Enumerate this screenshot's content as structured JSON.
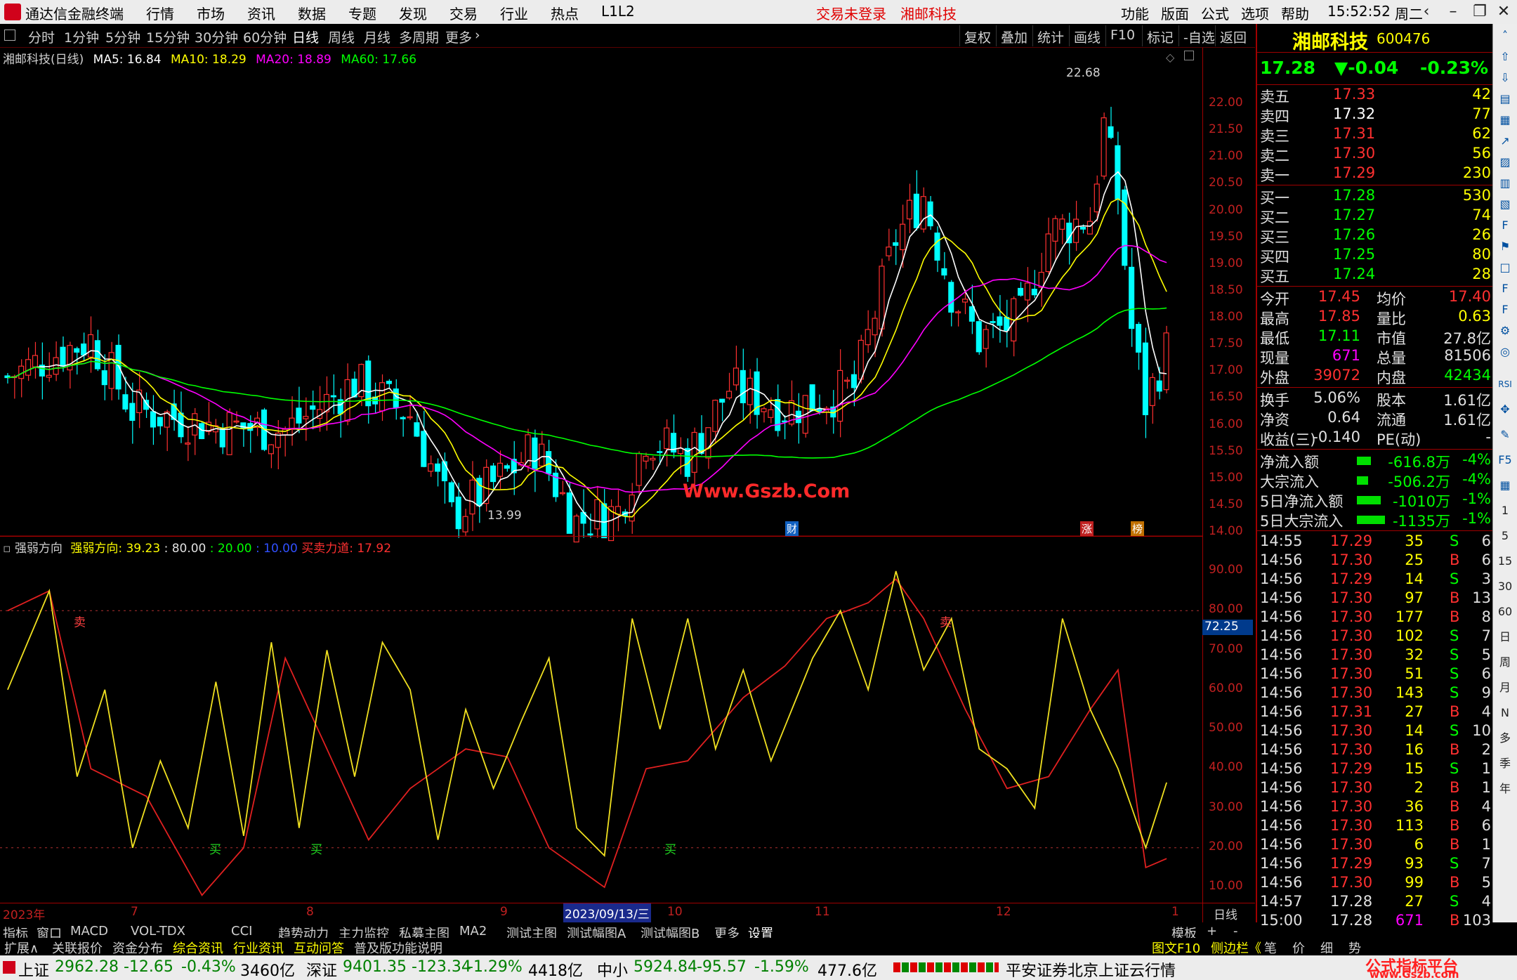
{
  "titlebar": {
    "app_title": "通达信金融终端",
    "menu": [
      "行情",
      "市场",
      "资讯",
      "数据",
      "专题",
      "发现",
      "交易",
      "行业",
      "热点",
      "L1L2"
    ],
    "trade_status": "交易未登录",
    "stock_name": "湘邮科技",
    "right_menu": [
      "功能",
      "版面",
      "公式",
      "选项",
      "帮助"
    ],
    "time": "15:52:52",
    "weekday": "周二"
  },
  "toolbar": {
    "periods": [
      "分时",
      "1分钟",
      "5分钟",
      "15分钟",
      "30分钟",
      "60分钟",
      "日线",
      "周线",
      "月线",
      "多周期",
      "更多"
    ],
    "selected": "日线",
    "buttons": [
      "复权",
      "叠加",
      "统计",
      "画线",
      "F10",
      "标记",
      "-自选",
      "返回"
    ]
  },
  "chart_header": {
    "name": "湘邮科技(日线)",
    "ma5": "MA5: 16.84",
    "ma10": "MA10: 18.29",
    "ma20": "MA20: 18.89",
    "ma60": "MA60: 17.66"
  },
  "price_axis": [
    "22.00",
    "21.50",
    "21.00",
    "20.50",
    "20.00",
    "19.50",
    "19.00",
    "18.50",
    "18.00",
    "17.50",
    "17.00",
    "16.50",
    "16.00",
    "15.50",
    "15.00",
    "14.50",
    "14.00"
  ],
  "price_annotations": {
    "high": "22.68",
    "low": "13.99",
    "markers": [
      "财",
      "涨",
      "榜"
    ]
  },
  "indicator_header": {
    "name": "强弱方向",
    "value1": "强弱方向: 39.23",
    "value2": ": 80.00",
    "value3": ": 20.00",
    "value4": ": 10.00",
    "value5": "买卖力道: 17.92"
  },
  "indicator_axis": [
    "90.00",
    "80.00",
    "70.00",
    "60.00",
    "50.00",
    "40.00",
    "30.00",
    "20.00",
    "10.00"
  ],
  "indicator_current": "72.25",
  "indicator_signals": {
    "sell": "卖",
    "buy": "买"
  },
  "watermark_center": "Www.Gszb.Com",
  "date_axis": {
    "labels": [
      "2023年",
      "7",
      "8",
      "9",
      "10",
      "11",
      "12",
      "1"
    ],
    "highlight": "2023/09/13/三",
    "period": "日线"
  },
  "bottom_tabs": [
    "指标",
    "窗口",
    "MACD",
    "VOL-TDX",
    "CCI",
    "趋势动力",
    "主力监控",
    "私募主图",
    "MA2",
    "测试主图",
    "测试幅图A",
    "测试幅图B",
    "更多",
    "设置"
  ],
  "bottom_tabs_right": [
    "模板",
    "+",
    "-"
  ],
  "bottom_tabs2": [
    "扩展∧",
    "关联报价",
    "资金分布",
    "综合资讯",
    "行业资讯",
    "互动问答",
    "普及版功能说明"
  ],
  "bottom_tabs2_right": [
    "图文F10",
    "侧边栏《",
    "笔",
    "价",
    "细",
    "势"
  ],
  "quote": {
    "name": "湘邮科技",
    "code": "600476",
    "price": "17.28",
    "change": "▼-0.04",
    "pct": "-0.23%",
    "asks": [
      {
        "label": "卖五",
        "price": "17.33",
        "vol": "42"
      },
      {
        "label": "卖四",
        "price": "17.32",
        "vol": "77"
      },
      {
        "label": "卖三",
        "price": "17.31",
        "vol": "62"
      },
      {
        "label": "卖二",
        "price": "17.30",
        "vol": "56"
      },
      {
        "label": "卖一",
        "price": "17.29",
        "vol": "230"
      }
    ],
    "bids": [
      {
        "label": "买一",
        "price": "17.28",
        "vol": "530"
      },
      {
        "label": "买二",
        "price": "17.27",
        "vol": "74"
      },
      {
        "label": "买三",
        "price": "17.26",
        "vol": "26"
      },
      {
        "label": "买四",
        "price": "17.25",
        "vol": "80"
      },
      {
        "label": "买五",
        "price": "17.24",
        "vol": "28"
      }
    ],
    "stats": [
      {
        "l1": "今开",
        "v1": "17.45",
        "l2": "均价",
        "v2": "17.40",
        "c1": "#ff3030",
        "c2": "#ff3030"
      },
      {
        "l1": "最高",
        "v1": "17.85",
        "l2": "量比",
        "v2": "0.63",
        "c1": "#ff3030",
        "c2": "#ffff00"
      },
      {
        "l1": "最低",
        "v1": "17.11",
        "l2": "市值",
        "v2": "27.8亿",
        "c1": "#00ff00",
        "c2": "#e0e0e0"
      },
      {
        "l1": "现量",
        "v1": "671",
        "l2": "总量",
        "v2": "81506",
        "c1": "#ff00ff",
        "c2": "#e0e0e0"
      },
      {
        "l1": "外盘",
        "v1": "39072",
        "l2": "内盘",
        "v2": "42434",
        "c1": "#ff3030",
        "c2": "#00ff00"
      }
    ],
    "stats2": [
      {
        "l1": "换手",
        "v1": "5.06%",
        "l2": "股本",
        "v2": "1.61亿"
      },
      {
        "l1": "净资",
        "v1": "0.64",
        "l2": "流通",
        "v2": "1.61亿"
      },
      {
        "l1": "收益(三)",
        "v1": "-0.140",
        "l2": "PE(动)",
        "v2": "-"
      }
    ],
    "flows": [
      {
        "label": "净流入额",
        "value": "-616.8万",
        "pct": "-4%",
        "w": 20
      },
      {
        "label": "大宗流入",
        "value": "-506.2万",
        "pct": "-4%",
        "w": 16
      },
      {
        "label": "5日净流入额",
        "value": "-1010万",
        "pct": "-1%",
        "w": 34
      },
      {
        "label": "5日大宗流入",
        "value": "-1135万",
        "pct": "-1%",
        "w": 40
      }
    ],
    "ticks": [
      [
        "14:55",
        "17.29",
        "35",
        "S",
        "6"
      ],
      [
        "14:56",
        "17.30",
        "25",
        "B",
        "6"
      ],
      [
        "14:56",
        "17.29",
        "14",
        "S",
        "3"
      ],
      [
        "14:56",
        "17.30",
        "97",
        "B",
        "13"
      ],
      [
        "14:56",
        "17.30",
        "177",
        "B",
        "8"
      ],
      [
        "14:56",
        "17.30",
        "102",
        "S",
        "7"
      ],
      [
        "14:56",
        "17.30",
        "32",
        "S",
        "5"
      ],
      [
        "14:56",
        "17.30",
        "51",
        "S",
        "6"
      ],
      [
        "14:56",
        "17.30",
        "143",
        "S",
        "9"
      ],
      [
        "14:56",
        "17.31",
        "27",
        "B",
        "4"
      ],
      [
        "14:56",
        "17.30",
        "14",
        "S",
        "10"
      ],
      [
        "14:56",
        "17.30",
        "16",
        "B",
        "2"
      ],
      [
        "14:56",
        "17.29",
        "15",
        "S",
        "1"
      ],
      [
        "14:56",
        "17.30",
        "2",
        "B",
        "1"
      ],
      [
        "14:56",
        "17.30",
        "36",
        "B",
        "4"
      ],
      [
        "14:56",
        "17.30",
        "113",
        "B",
        "6"
      ],
      [
        "14:56",
        "17.30",
        "6",
        "B",
        "1"
      ],
      [
        "14:56",
        "17.29",
        "93",
        "S",
        "7"
      ],
      [
        "14:56",
        "17.30",
        "99",
        "B",
        "5"
      ],
      [
        "14:57",
        "17.28",
        "27",
        "S",
        "4"
      ],
      [
        "15:00",
        "17.28",
        "671",
        "B",
        "103"
      ]
    ]
  },
  "side_icons": [
    "RSI",
    "F5",
    "1",
    "5",
    "15",
    "30",
    "60",
    "日",
    "周",
    "月",
    "N",
    "多",
    "季",
    "年"
  ],
  "status": {
    "sh_label": "上证",
    "sh_val": "2962.28",
    "sh_chg": "-12.65",
    "sh_pct": "-0.43%",
    "sh_amt": "3460亿",
    "sz_label": "深证",
    "sz_val": "9401.35",
    "sz_chg": "-123.34",
    "sz_pct": "-1.29%",
    "sz_amt": "4418亿",
    "zx_label": "中小",
    "zx_val": "5924.84",
    "zx_chg": "-95.57",
    "zx_pct": "-1.59%",
    "zx_amt": "477.6亿",
    "broker": "平安证券北京上证云行情",
    "brand": "公式指标平台",
    "brand_url": "www.Gszb.com"
  },
  "colors": {
    "up": "#ff3030",
    "down": "#00ffff",
    "ma5": "#ffffff",
    "ma10": "#ffff00",
    "ma20": "#ff00ff",
    "ma60": "#00ff00"
  }
}
